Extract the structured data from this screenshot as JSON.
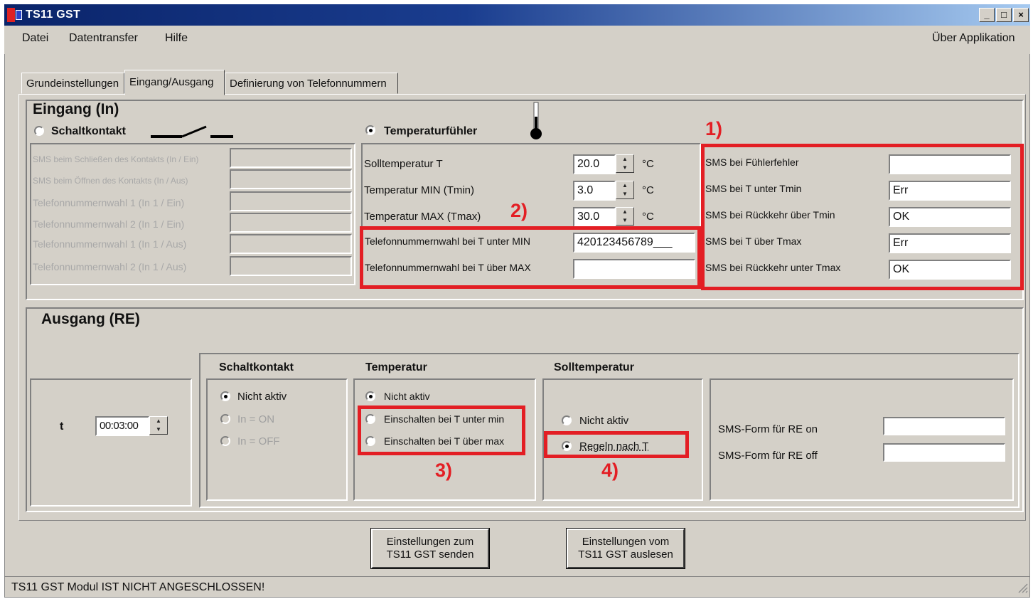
{
  "window": {
    "title": "TS11 GST",
    "buttons": [
      "_",
      "□",
      "×"
    ]
  },
  "menu": {
    "items": [
      "Datei",
      "Datentransfer",
      "Hilfe"
    ],
    "about": "Über Applikation"
  },
  "tabs": [
    {
      "label": "Grundeinstellungen",
      "active": false
    },
    {
      "label": "Eingang/Ausgang",
      "active": true
    },
    {
      "label": "Definierung von Telefonnummern",
      "active": false
    }
  ],
  "eingang": {
    "title": "Eingang (In)",
    "schaltkontakt": {
      "label": "Schaltkontakt",
      "selected": false,
      "rows": [
        {
          "label": "SMS beim Schließen des Kontakts (In / Ein)",
          "value": ""
        },
        {
          "label": "SMS beim Öffnen des Kontakts (In / Aus)",
          "value": ""
        },
        {
          "label": "Telefonnummernwahl 1 (In 1 / Ein)",
          "value": ""
        },
        {
          "label": "Telefonnummernwahl 2 (In 1 / Ein)",
          "value": ""
        },
        {
          "label": "Telefonnummernwahl 1 (In 1 / Aus)",
          "value": ""
        },
        {
          "label": "Telefonnummernwahl 2 (In 1 / Aus)",
          "value": ""
        }
      ]
    },
    "temperaturfuehler": {
      "label": "Temperaturfühler",
      "selected": true,
      "unit": "°C",
      "solltemperatur": {
        "label": "Solltemperatur T",
        "value": "20.0"
      },
      "tmin": {
        "label": "Temperatur MIN (Tmin)",
        "value": "3.0"
      },
      "tmax": {
        "label": "Temperatur MAX (Tmax)",
        "value": "30.0"
      },
      "tel_unter_min": {
        "label": "Telefonnummernwahl bei T unter MIN",
        "value": "420123456789___"
      },
      "tel_ueber_max": {
        "label": "Telefonnummernwahl bei T über MAX",
        "value": ""
      }
    },
    "sms": [
      {
        "label": "SMS bei Fühlerfehler",
        "value": ""
      },
      {
        "label": "SMS bei T unter Tmin",
        "value": "Err"
      },
      {
        "label": "SMS bei Rückkehr über Tmin",
        "value": "OK"
      },
      {
        "label": "SMS bei T über Tmax",
        "value": "Err"
      },
      {
        "label": "SMS bei Rückkehr unter Tmax",
        "value": "OK"
      }
    ]
  },
  "ausgang": {
    "title": "Ausgang (RE)",
    "t_label": "t",
    "t_value": "00:03:00",
    "schaltkontakt": {
      "title": "Schaltkontakt",
      "options": [
        {
          "label": "Nicht aktiv",
          "selected": true,
          "enabled": true
        },
        {
          "label": "In = ON",
          "selected": false,
          "enabled": false
        },
        {
          "label": "In = OFF",
          "selected": false,
          "enabled": false
        }
      ]
    },
    "temperatur": {
      "title": "Temperatur",
      "options": [
        {
          "label": "Nicht aktiv",
          "selected": true
        },
        {
          "label": "Einschalten bei T unter min",
          "selected": false
        },
        {
          "label": "Einschalten bei T über max",
          "selected": false
        }
      ]
    },
    "solltemperatur": {
      "title": "Solltemperatur",
      "options": [
        {
          "label": "Nicht aktiv",
          "selected": false
        },
        {
          "label": "Regeln nach  T",
          "selected": true
        }
      ]
    },
    "sms_form": [
      {
        "label": "SMS-Form für RE on",
        "value": ""
      },
      {
        "label": "SMS-Form für RE off",
        "value": ""
      }
    ]
  },
  "annotations": [
    "1)",
    "2)",
    "3)",
    "4)"
  ],
  "buttons": {
    "send": [
      "Einstellungen zum",
      "TS11 GST senden"
    ],
    "read": [
      "Einstellungen vom",
      "TS11 GST auslesen"
    ]
  },
  "status": "TS11 GST Modul IST NICHT ANGESCHLOSSEN!",
  "colors": {
    "annotation": "#e31e24",
    "titlebar": "#0a246a",
    "face": "#d4d0c8"
  }
}
